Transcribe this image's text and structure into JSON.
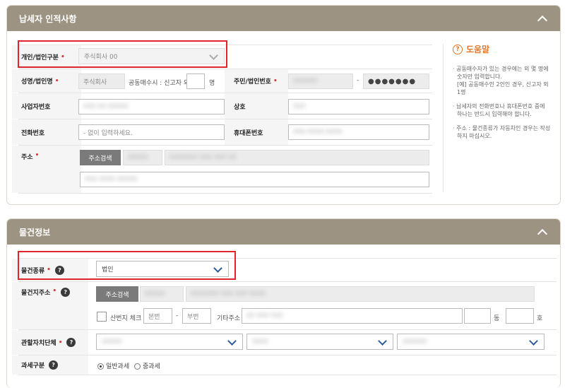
{
  "taxpayer": {
    "title": "납세자 인적사항",
    "type_label": "개인/법인구분",
    "type_value": "주식회사 00",
    "name_label": "성명/법인명",
    "name_value": "주식회사",
    "joint_text": "공동매수시 : 신고자 외",
    "joint_unit": "명",
    "reg_label": "주민/법인번호",
    "reg_dash": "-",
    "reg_masked": "●●●●●●●",
    "biz_label": "사업자번호",
    "trade_label": "상호",
    "phone_label": "전화번호",
    "phone_placeholder": "- 없이 입력하세요.",
    "mobile_label": "휴대폰번호",
    "address_label": "주소",
    "address_button": "주소검색"
  },
  "help": {
    "title": "도움말",
    "items": [
      "· 공동매수자가 있는 경우에는 외 몇 명에 숫자만 입력합니다.",
      "[예] 공동매수인 2인인 경우, 신고자 외 1명",
      "· 납세자의 전화번호나 휴대폰번호 중에 하나는 반드시 입력해야 합니다.",
      "· 주소 : 물건종류가 자동차인 경우는 작성하지 마십시오."
    ]
  },
  "property": {
    "title": "물건정보",
    "kind_label": "물건종류",
    "kind_value": "법인",
    "addr_label": "물건지주소",
    "addr_button": "주소검색",
    "mountain_label": "산번지 체크",
    "main_no_placeholder": "본번",
    "sub_no_placeholder": "부번",
    "dash": "-",
    "other_addr_label": "기타주소",
    "dong_unit": "동",
    "ho_unit": "호",
    "jurisdiction_label": "관할자치단체",
    "taxtype_label": "과세구분",
    "taxtype_option1": "일반과세",
    "taxtype_option2": "중과세"
  },
  "colors": {
    "header": "#9d9382",
    "required": "#d23a3a",
    "highlight": "#e0242c",
    "help": "#e0772a"
  }
}
